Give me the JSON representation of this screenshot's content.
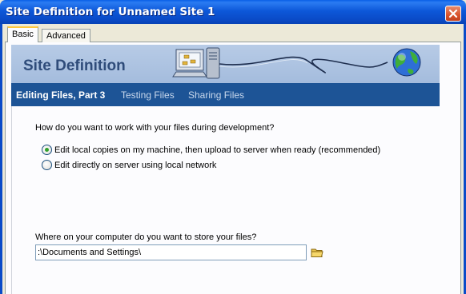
{
  "window": {
    "title": "Site Definition for Unnamed Site 1",
    "close_icon": "close-icon"
  },
  "tabs": [
    {
      "label": "Basic",
      "active": true
    },
    {
      "label": "Advanced",
      "active": false
    }
  ],
  "banner": {
    "title": "Site Definition",
    "art_icons": [
      "computer-server-icon",
      "globe-icon"
    ]
  },
  "steps": [
    {
      "label": "Editing Files, Part 3",
      "current": true
    },
    {
      "label": "Testing Files",
      "current": false
    },
    {
      "label": "Sharing Files",
      "current": false
    }
  ],
  "form": {
    "question_work": "How do you want to work with your files during development?",
    "options": [
      {
        "label": "Edit local copies on my machine, then upload to server when ready (recommended)",
        "selected": true
      },
      {
        "label": "Edit directly on server using local network",
        "selected": false
      }
    ],
    "question_store": "Where on your computer do you want to store your files?",
    "path_value": ":\\Documents and Settings\\",
    "browse_icon": "folder-icon"
  },
  "colors": {
    "titlebar": "#0A4BC8",
    "banner": "#A4BCDD",
    "steps_bar": "#1D5496",
    "dialog_bg": "#ECE9D8"
  }
}
